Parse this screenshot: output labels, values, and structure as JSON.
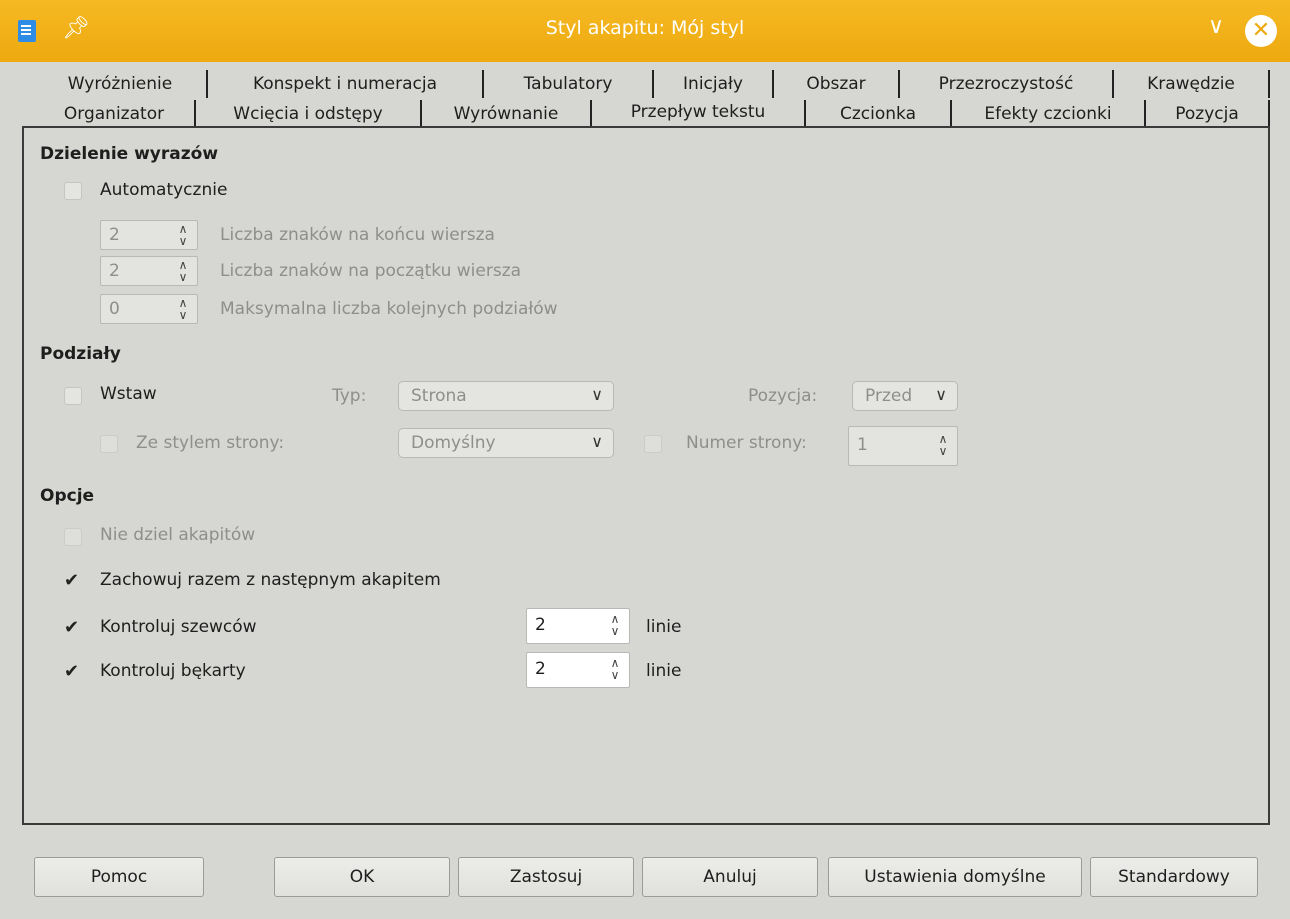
{
  "window": {
    "title": "Styl akapitu: Mój styl"
  },
  "tabs_row1": [
    "Wyróżnienie",
    "Konspekt i numeracja",
    "Tabulatory",
    "Inicjały",
    "Obszar",
    "Przezroczystość",
    "Krawędzie"
  ],
  "tabs_row2": [
    "Organizator",
    "Wcięcia i odstępy",
    "Wyrównanie",
    "Przepływ tekstu",
    "Czcionka",
    "Efekty czcionki",
    "Pozycja"
  ],
  "active_tab": "Przepływ tekstu",
  "hyphenation": {
    "heading": "Dzielenie wyrazów",
    "auto_label": "Automatycznie",
    "auto_checked": false,
    "end_value": "2",
    "end_label": "Liczba znaków na końcu wiersza",
    "start_value": "2",
    "start_label": "Liczba znaków na początku wiersza",
    "max_value": "0",
    "max_label": "Maksymalna liczba kolejnych podziałów"
  },
  "breaks": {
    "heading": "Podziały",
    "insert_label": "Wstaw",
    "type_label": "Typ:",
    "type_value": "Strona",
    "position_label": "Pozycja:",
    "position_value": "Przed",
    "page_style_label": "Ze stylem strony:",
    "page_style_value": "Domyślny",
    "page_number_label": "Numer strony:",
    "page_number_value": "1"
  },
  "options": {
    "heading": "Opcje",
    "dont_split_label": "Nie dziel akapitów",
    "keep_next_label": "Zachowuj razem z następnym akapitem",
    "orphan_label": "Kontroluj szewców",
    "orphan_value": "2",
    "widow_label": "Kontroluj bękarty",
    "widow_value": "2",
    "lines_unit": "linie"
  },
  "buttons": {
    "help": "Pomoc",
    "ok": "OK",
    "apply": "Zastosuj",
    "cancel": "Anuluj",
    "reset": "Ustawienia domyślne",
    "standard": "Standardowy"
  },
  "colors": {
    "titlebar": "#f0ad16",
    "background": "#d6d6d2"
  }
}
